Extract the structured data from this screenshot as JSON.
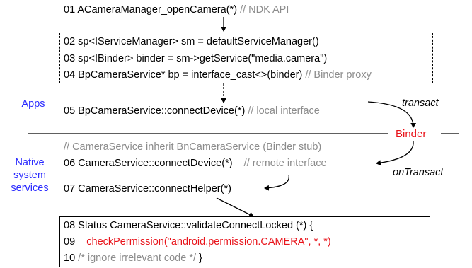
{
  "lines": {
    "l01": {
      "code": "01 ACameraManager_openCamera(*) ",
      "comment": "// NDK API"
    },
    "l02": {
      "code": "02 sp<IServiceManager> sm = defaultServiceManager()"
    },
    "l03": {
      "code": "03 sp<IBinder> binder = sm->getService(\"media.camera\")"
    },
    "l04": {
      "code": "04 BpCameraService* bp = interface_cast<>(binder) ",
      "comment": "// Binder proxy"
    },
    "l05": {
      "code": "05 BpCameraService::connectDevice(*) ",
      "comment": "// local interface"
    },
    "lc": {
      "comment": "// CameraService inherit BnCameraService (Binder stub)"
    },
    "l06": {
      "code": "06 CameraService::connectDevice(*)    ",
      "comment": "// remote interface"
    },
    "l07": {
      "code": "07 CameraService::connectHelper(*)"
    },
    "l08": {
      "code": "08 Status CameraService::validateConnectLocked (*) {"
    },
    "l09": {
      "num": "09    ",
      "call": "checkPermission(\"android.permission.CAMERA\", *, *)"
    },
    "l10": {
      "num": "10 ",
      "comment": "/* ignore irrelevant code */",
      "close": " }"
    }
  },
  "sides": {
    "apps": "Apps",
    "native_line1": "Native",
    "native_line2": "system",
    "native_line3": "services"
  },
  "binder": {
    "label": "Binder",
    "transact": "transact",
    "on_transact": "onTransact"
  },
  "colors": {
    "comment": "#8c8c8c",
    "highlight": "#e8141b",
    "side_label": "#2b2bff"
  }
}
